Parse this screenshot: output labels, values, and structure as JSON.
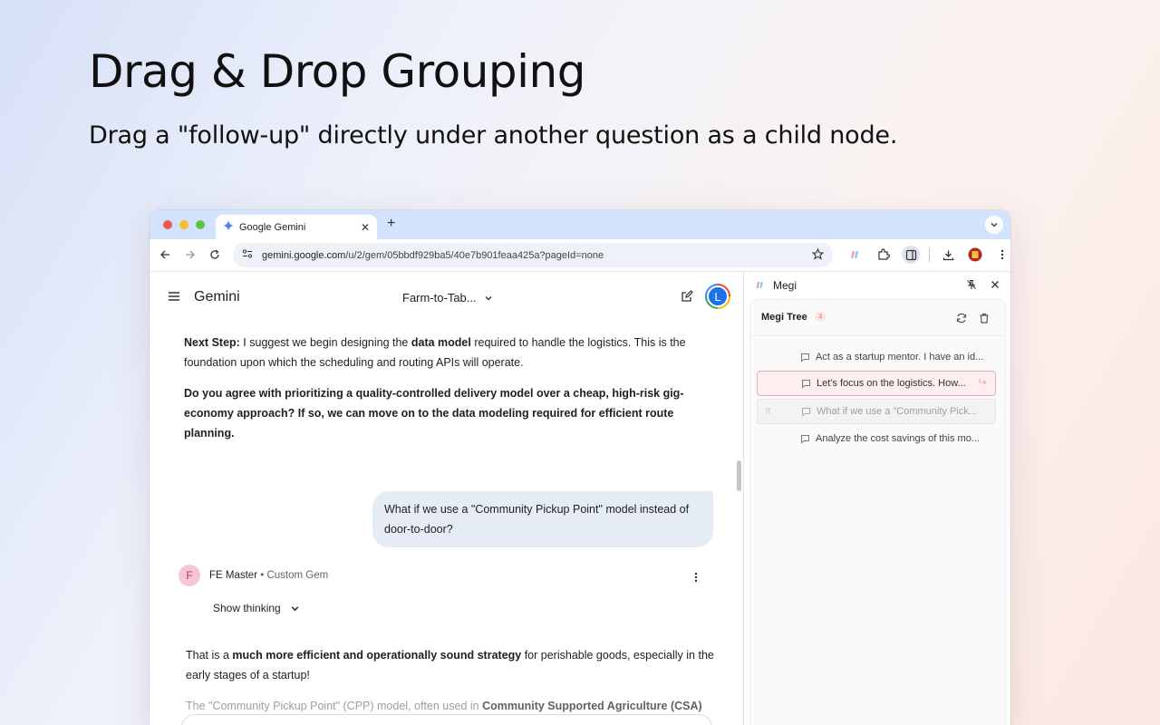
{
  "hero": {
    "title": "Drag & Drop Grouping",
    "subtitle": "Drag a \"follow-up\" directly under another question as a child node."
  },
  "browser": {
    "tab_title": "Google Gemini",
    "url_host": "gemini.google.com",
    "url_path": "/u/2/gem/05bbdf929ba5/40e7b901feaa425a?pageId=none"
  },
  "gemini": {
    "brand": "Gemini",
    "gem_selector": "Farm-to-Tab...",
    "avatar_letter": "L",
    "next_step_label": "Next Step:",
    "next_step_text_1": " I suggest we begin designing the ",
    "next_step_bold": "data model",
    "next_step_text_2": " required to handle the logistics. This is the foundation upon which the scheduling and routing APIs will operate.",
    "question_bold": "Do you agree with prioritizing a quality-controlled delivery model over a cheap, high-risk gig-economy approach? If so, we can move on to the data modeling required for efficient route planning.",
    "user_message": "What if we use a \"Community Pickup Point\" model instead of door-to-door?",
    "responder_initial": "F",
    "responder_name": "FE Master",
    "responder_tag": "• Custom Gem",
    "show_thinking": "Show thinking",
    "resp_text_1": "That is a ",
    "resp_bold": "much more efficient and operationally sound strategy",
    "resp_text_2": " for perishable goods, especially in the early stages of a startup!",
    "resp_fade_1": "The \"Community Pickup Point\" (CPP) model, often used in ",
    "resp_fade_bold": "Community Supported Agriculture (CSA)"
  },
  "megi": {
    "title": "Megi",
    "tree_title": "Megi Tree",
    "tree_count": "4",
    "items": [
      {
        "label": "Act as a startup mentor. I have an id..."
      },
      {
        "label": "Let's focus on the logistics. How..."
      },
      {
        "label": "What if we use a \"Community Pick..."
      },
      {
        "label": "Analyze the cost savings of this mo..."
      }
    ]
  }
}
